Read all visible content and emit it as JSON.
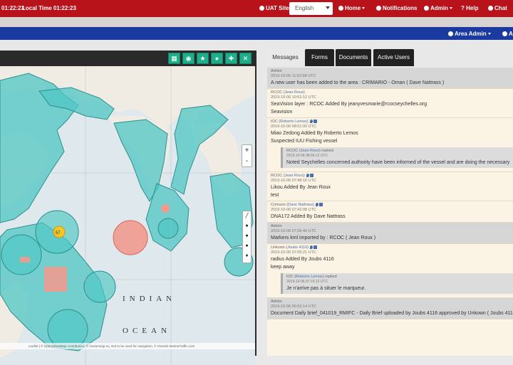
{
  "topbar": {
    "time_left": "01:22:23",
    "local_time": "Local Time 01:22:23",
    "uat_site": "UAT Site",
    "language": "English",
    "home": "Home",
    "notifications": "Notifications",
    "admin": "Admin",
    "help": "Help",
    "chat": "Chat"
  },
  "subnav": {
    "area_admin": "Area Admin",
    "right_item": "A"
  },
  "map": {
    "attribution": "Leaflet | © OpenStreetMap contributors, © Oceanmap eu, Not to be used for navigation, © Vessels MarineTraffic.com",
    "zoom_in": "+",
    "zoom_out": "-",
    "ocean_label_1": "INDIAN",
    "ocean_label_2": "OCEAN",
    "marker_label": "57",
    "tools": [
      "grid-icon",
      "pin-icon",
      "star-icon",
      "user-icon",
      "cross-icon",
      "close-icon"
    ]
  },
  "tabs": [
    "Messages",
    "Forms",
    "Documents",
    "Active Users"
  ],
  "messages": [
    {
      "sender": "Admin",
      "time": "2019-10-06 11:52:58 UTC",
      "text": "A new user has been added to the area : CRIMARIO - Oman ( Dave Nattrass )",
      "system": true
    },
    {
      "sender": "RCOC",
      "user": "Jean Roux",
      "time": "2019-10-06 10:52:12 UTC",
      "text": "SeaVision layer : RCOC Added By jeanyvesmarie@rcocseychelles.org",
      "text2": "Seavision"
    },
    {
      "sender": "IOC",
      "user": "Roberto Lemos",
      "time": "2019-10-06 08:51:00 UTC",
      "text": "Miao Zedong Added By Roberto Lemos",
      "text2": "Suspected IUU Fishing vessel",
      "reply": {
        "sender": "RCOC",
        "user": "Jean Roux",
        "label": "replied",
        "time": "2019-10-06 08:06:12 UTC",
        "text": "Noted Seychelles concerned authority have been informed of the vessel and are doing the necessary"
      }
    },
    {
      "sender": "RCOC",
      "user": "Jean Roux",
      "time": "2019-10-06 07:48:16 UTC",
      "text": "Likou Added By Jean Roux",
      "text2": "test"
    },
    {
      "sender": "Crimario",
      "user": "Dave Nattrass",
      "time": "2019-10-06 07:42:08 UTC",
      "text": "DNA172 Added By Dave Nattrass"
    },
    {
      "sender": "Admin",
      "time": "2019-10-06 07:36:40 UTC",
      "text": "Markers kml imported by : RCOC ( Jean Roux )",
      "system": true
    },
    {
      "sender": "Unkown",
      "user": "Joubs 4116",
      "time": "2019-10-06 07:05:21 UTC",
      "text": "radius Added By Joubs 4116",
      "text2": "keep away",
      "reply": {
        "sender": "IOC",
        "user": "Roberto Lemos",
        "label": "replied",
        "time": "2019-10-06 07:16:13 UTC",
        "text": "Je n'arrive pas à situer le marqueur."
      }
    },
    {
      "sender": "Admin",
      "time": "2019-10-06 06:52:14 UTC",
      "text": "Document Daily brief_041019_RMIFC - Daily Brief uploaded by Joubs 4116 approved by Unkown ( Joubs 4116 )",
      "system": true
    }
  ]
}
